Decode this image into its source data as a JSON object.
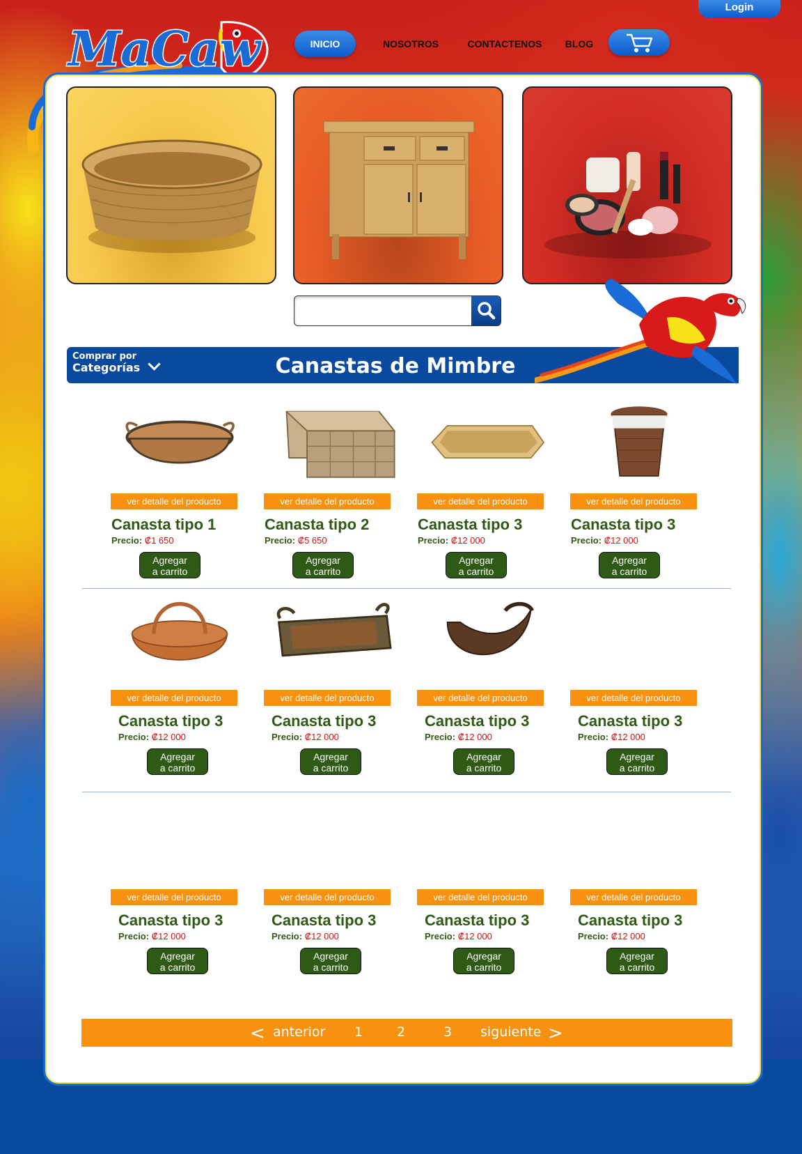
{
  "brand": {
    "logo_text": "MaCaw"
  },
  "header": {
    "login_label": "Login",
    "nav": [
      {
        "label": "INICIO"
      },
      {
        "label": "NOSOTROS"
      },
      {
        "label": "CONTACTENOS"
      },
      {
        "label": "BLOG"
      }
    ]
  },
  "search": {
    "placeholder": "",
    "value": ""
  },
  "category_bar": {
    "shop_by": "Comprar por",
    "categories": "Categorías",
    "title": "Canastas de Mimbre"
  },
  "labels": {
    "detail": "ver detalle del producto",
    "price": "Precio:",
    "add1": "Agregar",
    "add2": "a carrito"
  },
  "products": [
    {
      "name": "Canasta tipo 1",
      "price": "₡1 650"
    },
    {
      "name": "Canasta tipo 2",
      "price": "₡5 650"
    },
    {
      "name": "Canasta tipo 3",
      "price": "₡12 000"
    },
    {
      "name": "Canasta tipo 3",
      "price": "₡12 000"
    },
    {
      "name": "Canasta tipo 3",
      "price": "₡12 000"
    },
    {
      "name": "Canasta tipo 3",
      "price": "₡12 000"
    },
    {
      "name": "Canasta tipo 3",
      "price": "₡12 000"
    },
    {
      "name": "Canasta tipo 3",
      "price": "₡12 000"
    },
    {
      "name": "Canasta tipo 3",
      "price": "₡12 000"
    },
    {
      "name": "Canasta tipo 3",
      "price": "₡12 000"
    },
    {
      "name": "Canasta tipo 3",
      "price": "₡12 000"
    },
    {
      "name": "Canasta tipo 3",
      "price": "₡12 000"
    }
  ],
  "pagination": {
    "prev": "anterior",
    "pages": [
      "1",
      "2",
      "3"
    ],
    "next": "siguiente"
  },
  "colors": {
    "accent_blue": "#0b5ccc",
    "orange": "#f7910f",
    "green": "#2f5a15",
    "price_red": "#d4120e"
  }
}
